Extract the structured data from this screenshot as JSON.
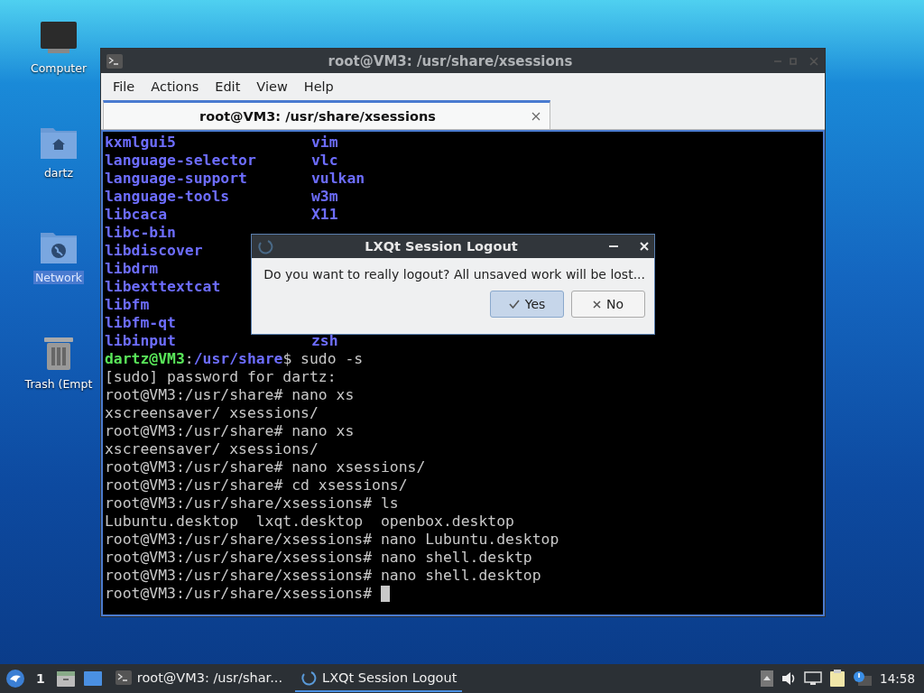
{
  "desktop_icons": [
    {
      "label": "Computer",
      "kind": "computer",
      "selected": false
    },
    {
      "label": "dartz",
      "kind": "home",
      "selected": false
    },
    {
      "label": "Network",
      "kind": "network",
      "selected": true
    },
    {
      "label": "Trash (Empt",
      "kind": "trash",
      "selected": false
    }
  ],
  "terminal": {
    "title": "root@VM3: /usr/share/xsessions",
    "menu": [
      "File",
      "Actions",
      "Edit",
      "View",
      "Help"
    ],
    "tabs": [
      {
        "label": "root@VM3: /usr/share/xsessions",
        "selected": true
      }
    ],
    "listing": [
      {
        "left": "kxmlgui5",
        "right": "vim"
      },
      {
        "left": "language-selector",
        "right": "vlc"
      },
      {
        "left": "language-support",
        "right": "vulkan"
      },
      {
        "left": "language-tools",
        "right": "w3m"
      },
      {
        "left": "libcaca",
        "right": "X11"
      },
      {
        "left": "libc-bin"
      },
      {
        "left": "libdiscover"
      },
      {
        "left": "libdrm"
      },
      {
        "left": "libexttextcat"
      },
      {
        "left": "libfm"
      },
      {
        "left": "libfm-qt"
      },
      {
        "left": "libinput",
        "right": "zsh"
      }
    ],
    "lines": [
      {
        "segments": [
          {
            "text": "dartz@VM3",
            "kind": "user"
          },
          {
            "text": ":",
            "kind": "plain"
          },
          {
            "text": "/usr/share",
            "kind": "path"
          },
          {
            "text": "$ sudo -s",
            "kind": "plain"
          }
        ]
      },
      {
        "segments": [
          {
            "text": "[sudo] password for dartz:",
            "kind": "plain"
          }
        ]
      },
      {
        "segments": [
          {
            "text": "root@VM3:/usr/share# nano xs",
            "kind": "plain"
          }
        ]
      },
      {
        "segments": [
          {
            "text": "xscreensaver/ xsessions/",
            "kind": "plain"
          }
        ]
      },
      {
        "segments": [
          {
            "text": "root@VM3:/usr/share# nano xs",
            "kind": "plain"
          }
        ]
      },
      {
        "segments": [
          {
            "text": "xscreensaver/ xsessions/",
            "kind": "plain"
          }
        ]
      },
      {
        "segments": [
          {
            "text": "root@VM3:/usr/share# nano xsessions/",
            "kind": "plain"
          }
        ]
      },
      {
        "segments": [
          {
            "text": "root@VM3:/usr/share# cd xsessions/",
            "kind": "plain"
          }
        ]
      },
      {
        "segments": [
          {
            "text": "root@VM3:/usr/share/xsessions# ls",
            "kind": "plain"
          }
        ]
      },
      {
        "segments": [
          {
            "text": "Lubuntu.desktop  lxqt.desktop  openbox.desktop",
            "kind": "plain"
          }
        ]
      },
      {
        "segments": [
          {
            "text": "root@VM3:/usr/share/xsessions# nano Lubuntu.desktop",
            "kind": "plain"
          }
        ]
      },
      {
        "segments": [
          {
            "text": "root@VM3:/usr/share/xsessions# nano shell.desktp",
            "kind": "plain"
          }
        ]
      },
      {
        "segments": [
          {
            "text": "root@VM3:/usr/share/xsessions# nano shell.desktop",
            "kind": "plain"
          }
        ]
      },
      {
        "segments": [
          {
            "text": "root@VM3:/usr/share/xsessions# ",
            "kind": "plain"
          }
        ],
        "cursor": true
      }
    ]
  },
  "dialog": {
    "title": "LXQt Session Logout",
    "message": "Do you want to really logout? All unsaved work will be lost...",
    "buttons": [
      {
        "label": "Yes",
        "kind": "yes",
        "selected": true
      },
      {
        "label": "No",
        "kind": "no",
        "selected": false
      }
    ]
  },
  "taskbar": {
    "workspace": "1",
    "tasks": [
      {
        "label": "root@VM3: /usr/shar...",
        "kind": "terminal",
        "selected": false
      },
      {
        "label": "LXQt Session Logout",
        "kind": "logout",
        "selected": true
      }
    ],
    "clock": "14:58"
  }
}
